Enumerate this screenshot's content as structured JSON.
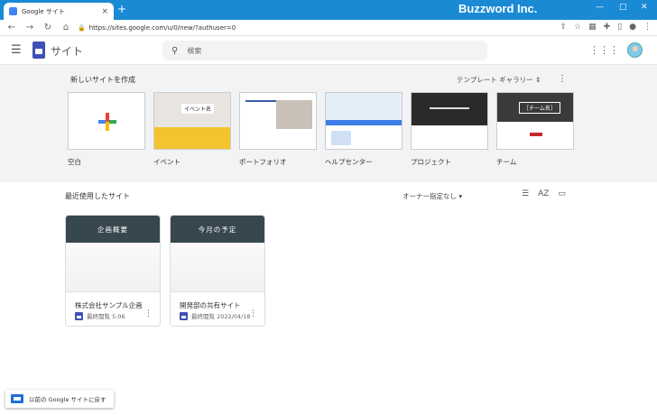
{
  "browser": {
    "tab_title": "Google サイト",
    "tab_close": "×",
    "new_tab": "+",
    "brand": "Buzzword Inc.",
    "url": "https://sites.google.com/u/0/new/?authuser=0"
  },
  "header": {
    "app_name": "サイト",
    "search_placeholder": "検索"
  },
  "new_site": {
    "title": "新しいサイトを作成",
    "gallery_label": "テンプレート ギャラリー",
    "templates": [
      {
        "label": "空白"
      },
      {
        "label": "イベント",
        "thumb_text": "イベント名"
      },
      {
        "label": "ポートフォリオ"
      },
      {
        "label": "ヘルプセンター"
      },
      {
        "label": "プロジェクト"
      },
      {
        "label": "チーム",
        "thumb_text": "［チーム名］"
      }
    ]
  },
  "recent": {
    "title": "最近使用したサイト",
    "owner_filter": "オーナー指定なし",
    "sites": [
      {
        "banner": "企画概要",
        "name": "株式会社サンプル企画",
        "meta": "最終閲覧 5:06"
      },
      {
        "banner": "今月の予定",
        "name": "開発部の共有サイト",
        "meta": "最終閲覧 2022/04/18"
      }
    ]
  },
  "back_link": "以前の Google サイトに戻す",
  "colors": {
    "titlebar": "#1a8ad4",
    "site_logo": "#3f51b5",
    "plus_blue": "#4285f4",
    "plus_red": "#ea4335",
    "plus_yellow": "#fbbc04",
    "plus_green": "#34a853"
  }
}
